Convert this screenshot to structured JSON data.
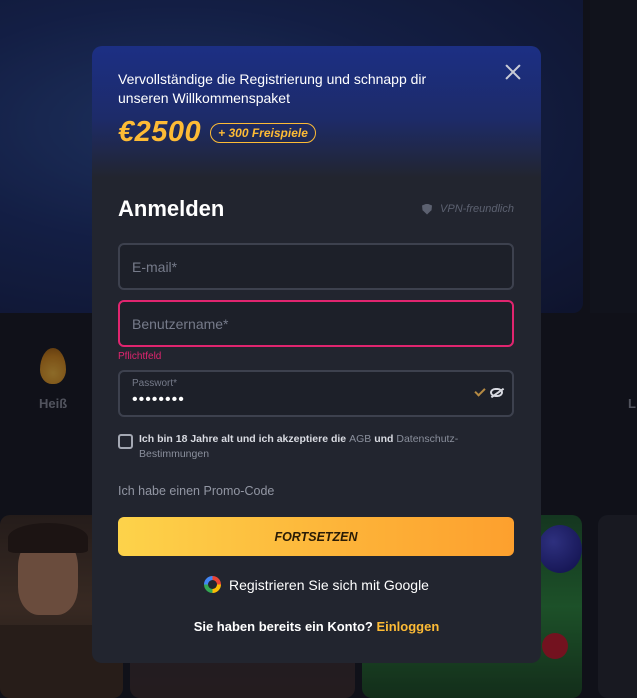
{
  "background": {
    "categories": [
      {
        "label": "Heiß",
        "icon": "flame-icon"
      },
      {
        "label": "L",
        "icon": ""
      }
    ]
  },
  "modal": {
    "header_text": "Vervollständige die Registrierung und schnapp dir unseren Willkommenspaket",
    "bonus_amount": "€2500",
    "bonus_freespins": "+ 300 Freispiele",
    "form_title": "Anmelden",
    "vpn_label": "VPN-freundlich",
    "email_placeholder": "E-mail*",
    "username_placeholder": "Benutzername*",
    "username_error": "Pflichtfeld",
    "password_label": "Passwort*",
    "password_value": "••••••••",
    "terms_prefix": "Ich bin 18 Jahre alt und ich akzeptiere die",
    "terms_link_agb": "AGB",
    "terms_and": "und",
    "terms_link_privacy": "Datenschutz-Bestimmungen",
    "promo_label": "Ich habe einen Promo-Code",
    "continue_label": "FORTSETZEN",
    "google_label": "Registrieren Sie sich mit Google",
    "login_prompt": "Sie haben bereits ein Konto?",
    "login_link": "Einloggen"
  },
  "colors": {
    "accent": "#fdbb35",
    "error": "#e0256f",
    "modal_bg": "#22252f",
    "header_blue": "#1c2f84"
  }
}
